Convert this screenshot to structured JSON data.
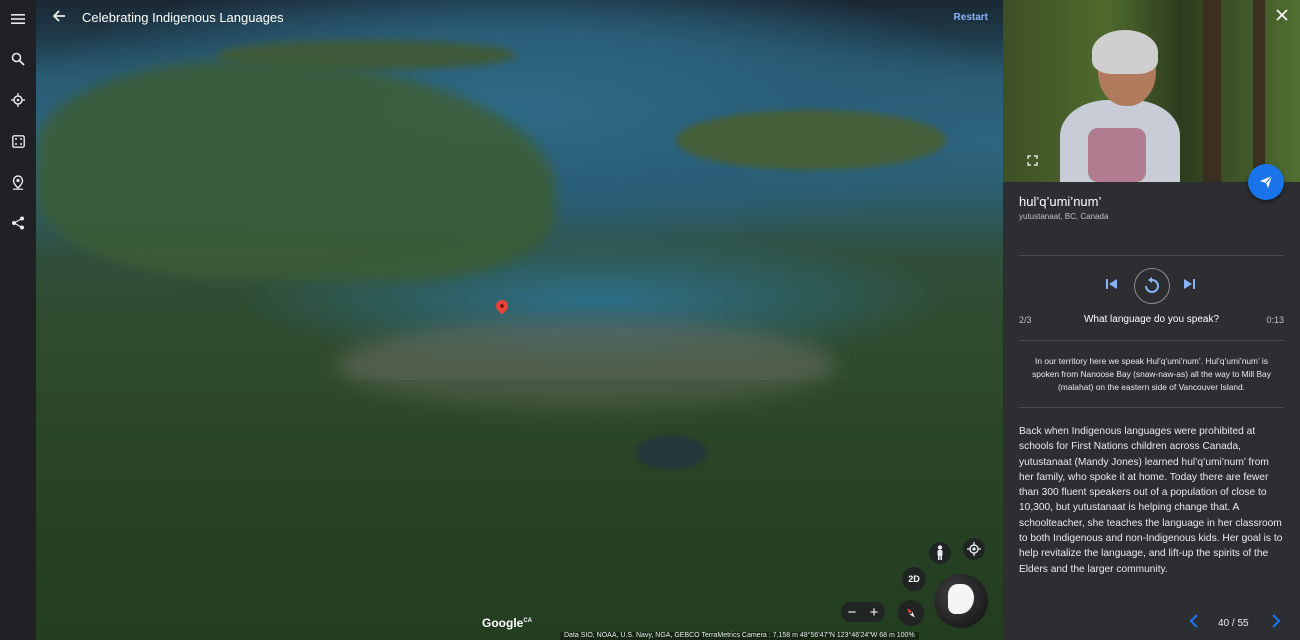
{
  "rail": {
    "icons": [
      "menu-icon",
      "search-icon",
      "voyager-icon",
      "feeling-lucky-icon",
      "projects-icon",
      "share-icon"
    ]
  },
  "topbar": {
    "title": "Celebrating Indigenous Languages",
    "restart": "Restart"
  },
  "map": {
    "logo": "Google",
    "logo_sup": "CA",
    "attribution": "Data SIO, NOAA, U.S. Navy, NGA, GEBCO TerraMetrics    Camera : 7,158 m    48°56'47\"N 123°46'24\"W    68 m    100%",
    "btn_2d": "2D"
  },
  "panel": {
    "name": "hul’q’umi’num’",
    "location": "yutustanaat, BC, Canada",
    "counter": "2/3",
    "question": "What language do you speak?",
    "duration": "0:13",
    "quote": "In our territory here we speak Hul’q’umi’num’. Hul’q’umi’num’ is spoken from Nanoose Bay (snaw-naw-as) all the way to Mill Bay (malahat) on the eastern side of Vancouver Island.",
    "body": "Back when Indigenous languages were prohibited at schools for First Nations children across Canada, yutustanaat (Mandy Jones) learned hul’q’umi’num’ from her family, who spoke it at home. Today there are fewer than 300 fluent speakers out of a population of close to 10,300, but yutustanaat is helping change that. A schoolteacher, she teaches the language in her classroom to both Indigenous and non-Indigenous kids. Her goal is to help revitalize the language, and lift-up the spirits of the Elders and the larger community.",
    "page": "40 / 55"
  },
  "colors": {
    "accent": "#1a73e8",
    "link": "#8ab4f8",
    "pin": "#ea4335"
  }
}
